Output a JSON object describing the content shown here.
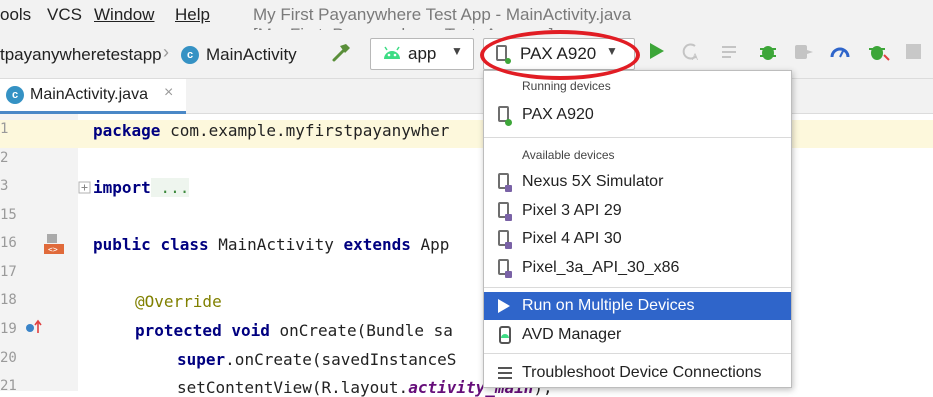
{
  "menubar": {
    "items": [
      "ools",
      "VCS",
      "Window",
      "Help"
    ],
    "window_title": "My First Payanywhere Test App - MainActivity.java [My_First_Payanywhere_Test_App.app]"
  },
  "navbar": {
    "breadcrumb_project": "tpayanywheretestapp",
    "breadcrumb_class": "MainActivity",
    "class_badge": "c",
    "config_selector": "app",
    "device_selector": "PAX A920"
  },
  "tab": {
    "label": "MainActivity.java",
    "badge": "c",
    "close": "×"
  },
  "gutter": {
    "line_numbers": [
      "1",
      "2",
      "3",
      "15",
      "16",
      "17",
      "18",
      "19",
      "20",
      "21"
    ]
  },
  "code": {
    "line1_kw": "package",
    "line1_rest": " com.example.myfirstpayanywher",
    "import_kw": "import",
    "import_rest": " ...",
    "class_public": "public",
    "class_class": "class",
    "class_name": " MainActivity ",
    "class_extends": "extends",
    "class_rest": " App",
    "override": "@Override",
    "method_protected": "protected",
    "method_void": "void",
    "method_rest": " onCreate(Bundle sa",
    "super_kw": "super",
    "super_rest": ".onCreate(savedInstanceS",
    "setcontent_prefix": "setContentView(R.layout.",
    "setcontent_field": "activity_main",
    "setcontent_suffix": ");"
  },
  "device_popup": {
    "running_header": "Running devices",
    "running_devices": [
      "PAX A920"
    ],
    "available_header": "Available devices",
    "available_devices": [
      "Nexus 5X Simulator",
      "Pixel 3 API 29",
      "Pixel 4 API 30",
      "Pixel_3a_API_30_x86"
    ],
    "run_multiple": "Run on Multiple Devices",
    "avd_manager": "AVD Manager",
    "troubleshoot": "Troubleshoot Device Connections"
  },
  "colors": {
    "selection": "#2f65ca",
    "highlight_circle": "#e11d24",
    "run_green": "#3da639",
    "android_green": "#3ddc84"
  }
}
